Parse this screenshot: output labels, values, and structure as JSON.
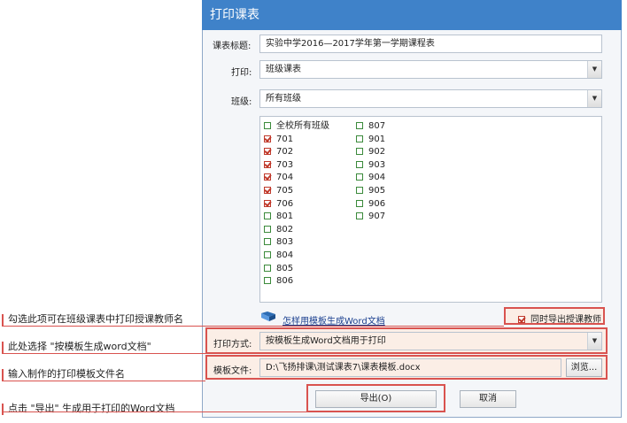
{
  "dialog": {
    "title": "打印课表"
  },
  "form": {
    "title_label": "课表标题:",
    "title_value": "实验中学2016—2017学年第一学期课程表",
    "print_label": "打印:",
    "print_value": "班级课表",
    "class_label": "班级:",
    "class_value": "所有班级"
  },
  "class_list": {
    "col1": [
      {
        "label": "全校所有班级",
        "checked": false
      },
      {
        "label": "701",
        "checked": true
      },
      {
        "label": "702",
        "checked": true
      },
      {
        "label": "703",
        "checked": true
      },
      {
        "label": "704",
        "checked": true
      },
      {
        "label": "705",
        "checked": true
      },
      {
        "label": "706",
        "checked": true
      },
      {
        "label": "801",
        "checked": false
      },
      {
        "label": "802",
        "checked": false
      },
      {
        "label": "803",
        "checked": false
      },
      {
        "label": "804",
        "checked": false
      },
      {
        "label": "805",
        "checked": false
      },
      {
        "label": "806",
        "checked": false
      }
    ],
    "col2": [
      {
        "label": "807",
        "checked": false
      },
      {
        "label": "901",
        "checked": false
      },
      {
        "label": "902",
        "checked": false
      },
      {
        "label": "903",
        "checked": false
      },
      {
        "label": "904",
        "checked": false
      },
      {
        "label": "905",
        "checked": false
      },
      {
        "label": "906",
        "checked": false
      },
      {
        "label": "907",
        "checked": false
      }
    ]
  },
  "template_link": "怎样用模板生成Word文档",
  "export_teacher": {
    "label": "同时导出授课教师",
    "checked": true
  },
  "print_mode": {
    "label": "打印方式:",
    "value": "按模板生成Word文档用于打印"
  },
  "template_file": {
    "label": "模板文件:",
    "value": "D:\\飞扬排课\\测试课表7\\课表模板.docx",
    "browse": "浏览..."
  },
  "buttons": {
    "export": "导出(O)",
    "cancel": "取消"
  },
  "annotations": {
    "a1": "勾选此项可在班级课表中打印授课教师名",
    "a2": "此处选择 \"按模板生成word文档\"",
    "a3": "输入制作的打印模板文件名",
    "a4": "点击 \"导出\" 生成用于打印的Word文档"
  },
  "colors": {
    "title_bar": "#3f82c9",
    "highlight": "#d9534f",
    "checked": "#c0392b",
    "unchecked": "#3b8a3b"
  }
}
